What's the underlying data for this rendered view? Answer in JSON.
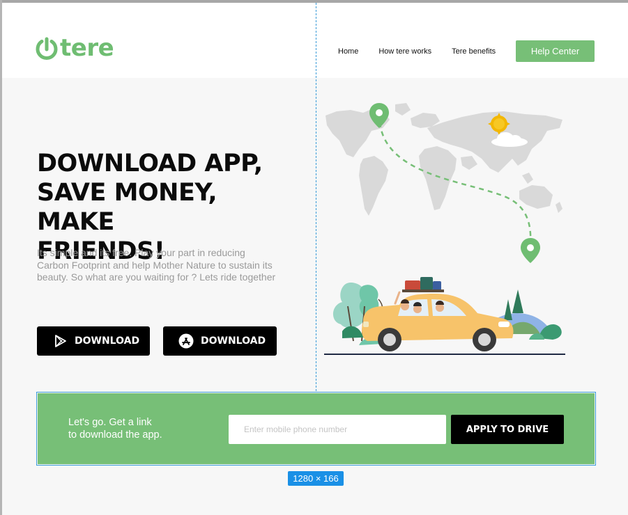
{
  "brand": {
    "logo_text": "tere",
    "color": "#6fbd72"
  },
  "nav": {
    "home": "Home",
    "how_it_works": "How tere works",
    "benefits": "Tere benefits",
    "help_center": "Help Center"
  },
  "hero": {
    "headline_lines": [
      "DOWNLOAD APP,",
      "SAVE MONEY, MAKE",
      "FRIENDS!"
    ],
    "subtext": "Its simple and its free. Play your part in reducing Carbon Footprint and help Mother Nature to sustain its beauty. So what are you waiting for ? Lets ride together",
    "download_play_label": "DOWNLOAD",
    "download_appstore_label": "DOWNLOAD"
  },
  "banner": {
    "text_line1": "Let's go. Get a link",
    "text_line2": "to download the app.",
    "phone_value": "",
    "phone_placeholder": "Enter mobile phone number",
    "apply_label": "APPLY TO DRIVE"
  },
  "selection_badge": "1280 × 166",
  "icons": {
    "logo": "power-icon",
    "play": "play-store-icon",
    "appstore": "app-store-icon"
  },
  "colors": {
    "accent": "#77bf77",
    "dark": "#000000",
    "selection": "#1a90e6"
  }
}
